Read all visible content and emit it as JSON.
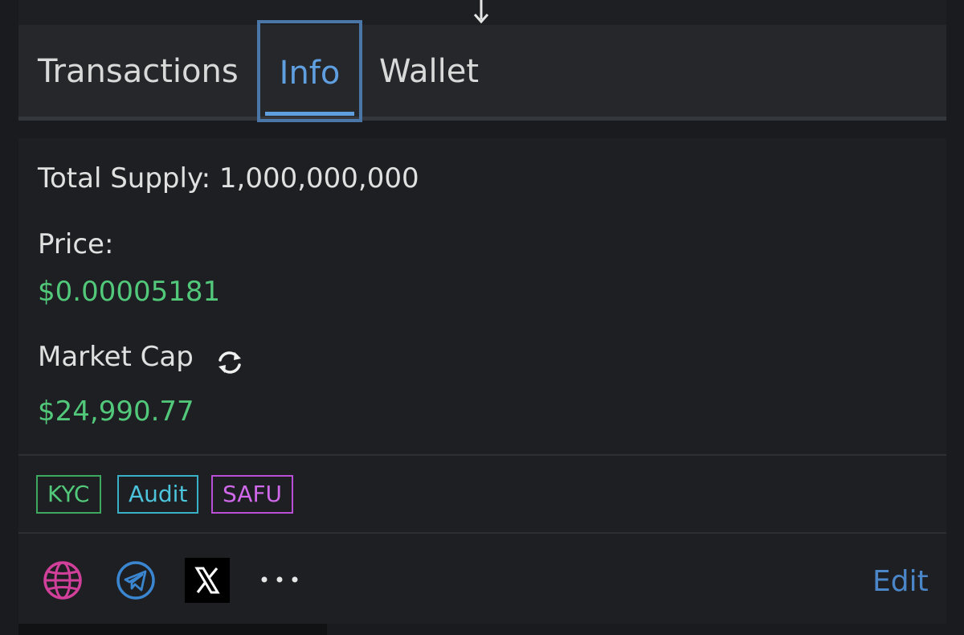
{
  "tabs": {
    "transactions": "Transactions",
    "info": "Info",
    "wallet": "Wallet",
    "active": "Info"
  },
  "info": {
    "total_supply_label": "Total Supply:",
    "total_supply_value": "1,000,000,000",
    "price_label": "Price:",
    "price_value": "$0.00005181",
    "market_cap_label": "Market Cap",
    "market_cap_value": "$24,990.77"
  },
  "badges": {
    "kyc": "KYC",
    "audit": "Audit",
    "safu": "SAFU"
  },
  "actions": {
    "edit_label": "Edit"
  },
  "icons": {
    "scroll_down": "down-arrow-icon",
    "refresh": "refresh-icon",
    "website": "globe-icon",
    "telegram": "telegram-icon",
    "x": "x-icon",
    "more": "more-icon"
  },
  "colors": {
    "background": "#1a1b1e",
    "panel": "#1e1f22",
    "tabbar": "#25272b",
    "accent_blue": "#5f9fe0",
    "positive_green": "#52c97a",
    "badge_kyc": "#52c97a",
    "badge_audit": "#4cc4dc",
    "badge_safu": "#d068ea",
    "globe": "#d0409a",
    "telegram": "#3a86d0"
  }
}
